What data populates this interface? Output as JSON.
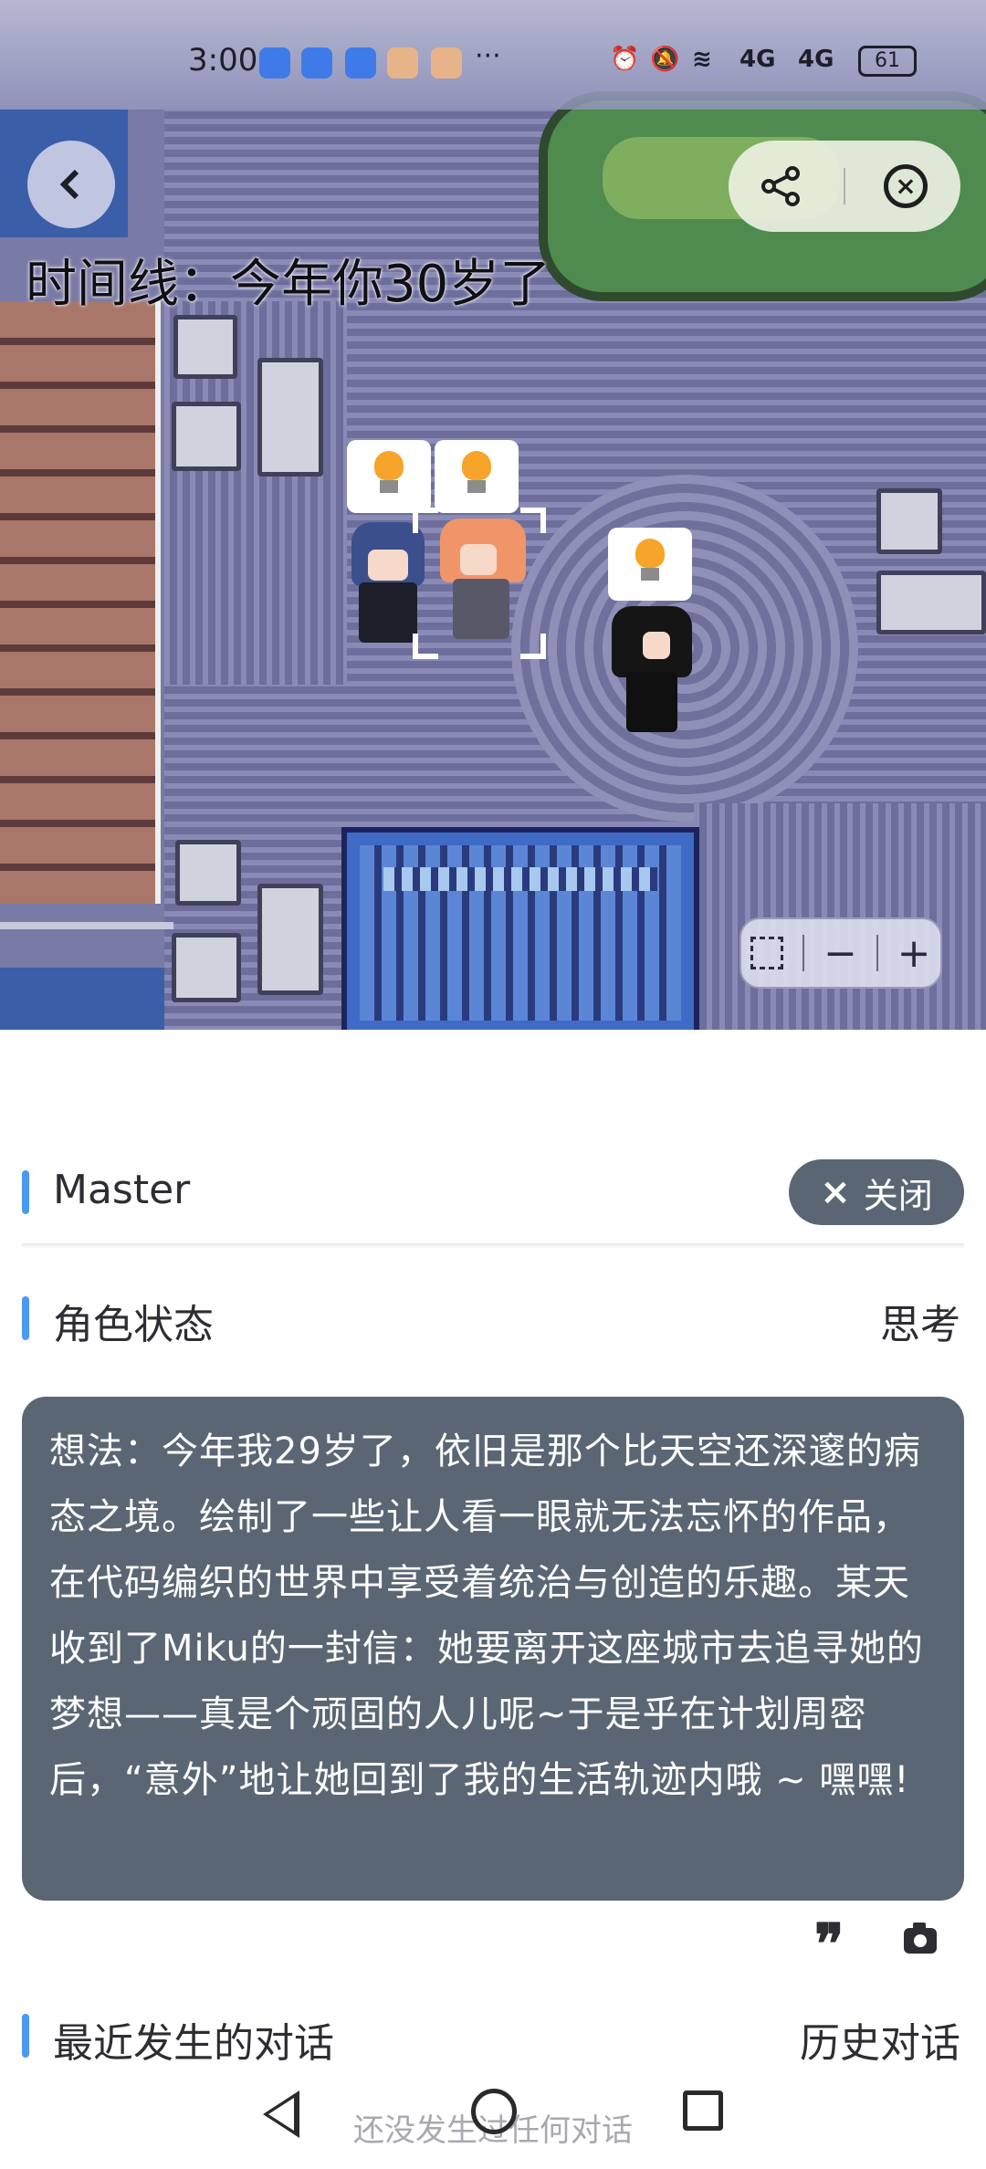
{
  "status_bar": {
    "time": "3:00",
    "dots": "···",
    "signal_1": "4G",
    "signal_2": "4G",
    "battery": "61"
  },
  "map": {
    "timeline_text": "时间线：今年你30岁了"
  },
  "zoom": {
    "minus": "−",
    "plus": "+"
  },
  "panel": {
    "master_label": "Master",
    "close_label": "关闭",
    "close_icon": "×",
    "status_title": "角色状态",
    "status_mode": "思考",
    "thought": "想法：今年我29岁了，依旧是那个比天空还深邃的病态之境。绘制了一些让人看一眼就无法忘怀的作品，在代码编织的世界中享受着统治与创造的乐趣。某天收到了Miku的一封信：她要离开这座城市去追寻她的梦想——真是个顽固的人儿呢~于是乎在计划周密后，“意外”地让她回到了我的生活轨迹内哦 ~ 嘿嘿!",
    "quote_icon": "❞",
    "recent_title": "最近发生的对话",
    "history_link": "历史对话",
    "empty_text": "还没发生过任何对话"
  }
}
